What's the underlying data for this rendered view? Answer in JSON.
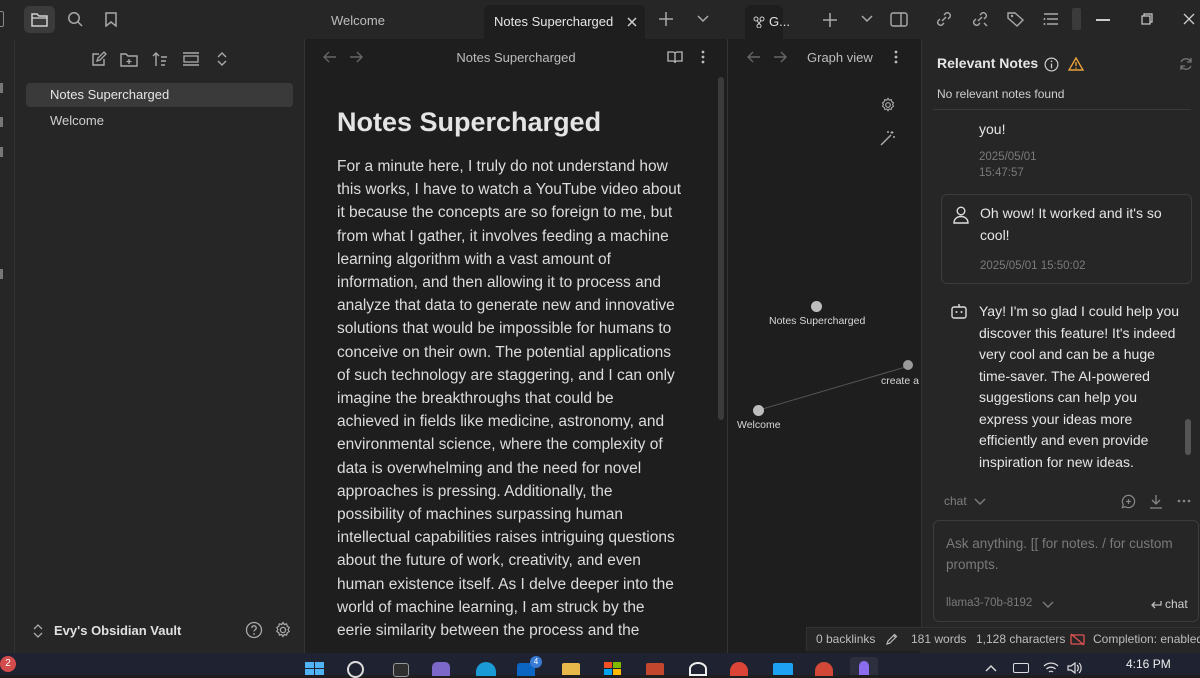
{
  "tabs": {
    "welcome": "Welcome",
    "active": "Notes Supercharged",
    "graph": "G...",
    "add_tab": "+"
  },
  "sidebar": {
    "files": [
      "Notes Supercharged",
      "Welcome"
    ],
    "vault_name": "Evy's Obsidian Vault"
  },
  "editor": {
    "header_title": "Notes Supercharged",
    "title": "Notes Supercharged",
    "body_lines": [
      "For a minute here, I truly do not understand how",
      "this works, I have to watch a YouTube video about",
      "it because the concepts are so foreign to me, but",
      "from what I gather, it involves feeding a machine",
      "learning algorithm with a vast amount of",
      "information, and then allowing it to process and",
      "analyze that data to generate new and innovative",
      "solutions that would be impossible for humans to",
      "conceive on their own. The potential applications",
      "of such technology are staggering, and I can only",
      "imagine the breakthroughs that could be",
      "achieved in fields like medicine, astronomy, and",
      "environmental science, where the complexity of",
      "data is overwhelming and the need for novel",
      "approaches is pressing. Additionally, the",
      "possibility of machines surpassing human",
      "intellectual capabilities raises intriguing questions",
      "about the future of work, creativity, and even",
      "human existence itself. As I delve deeper into the",
      "world of machine learning, I am struck by the",
      "eerie similarity between the process and the"
    ]
  },
  "graph": {
    "header_title": "Graph view",
    "nodes": [
      "Notes Supercharged",
      "create a l",
      "Welcome"
    ]
  },
  "relevant_notes": {
    "title": "Relevant Notes",
    "empty_message": "No relevant notes found"
  },
  "chat": {
    "prev_tail": "you!",
    "prev_ts_date": "2025/05/01",
    "prev_ts_time": "15:47:57",
    "user_message": "Oh wow! It worked and it's so cool!",
    "user_ts": "2025/05/01 15:50:02",
    "bot_message": "Yay! I'm so glad I could help you discover this feature! It's indeed very cool and can be a huge time-saver. The AI-powered suggestions can help you express your ideas more efficiently and even provide inspiration for new ideas.",
    "mode_label": "chat",
    "input_placeholder": "Ask anything. [[ for notes. / for custom prompts.",
    "model": "llama3-70b-8192",
    "send_label": "chat"
  },
  "status": {
    "backlinks": "0 backlinks",
    "words": "181 words",
    "characters": "1,128 characters",
    "completion": "Completion: enabled"
  },
  "taskbar": {
    "notification_count": "2",
    "time": "4:16 PM",
    "linkedin_badge": "4"
  },
  "colors": {
    "accent_warning": "#e6a23c",
    "completion_icon": "#e05252"
  }
}
